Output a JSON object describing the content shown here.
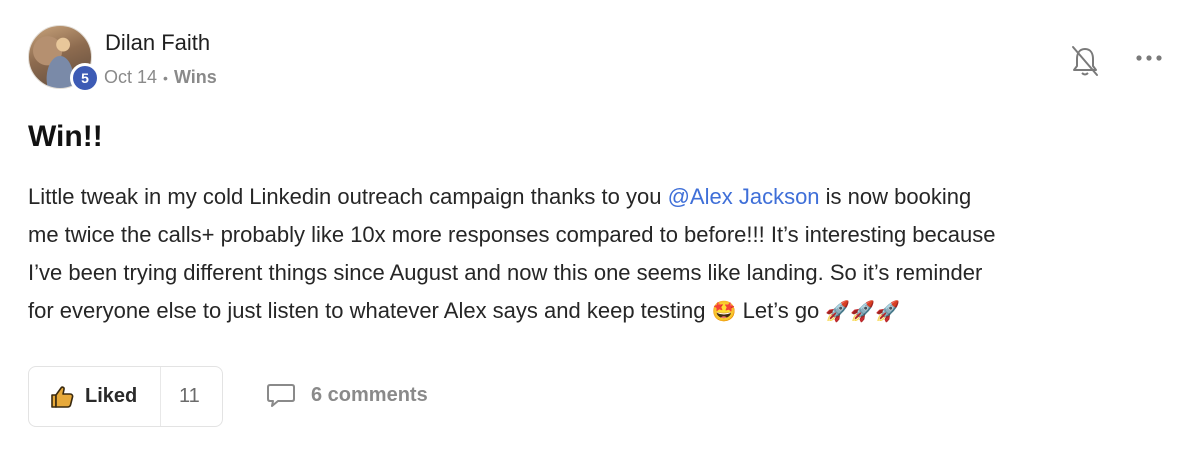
{
  "post": {
    "author": {
      "name": "Dilan Faith",
      "level": "5"
    },
    "meta": {
      "date": "Oct 14",
      "separator": "•",
      "category": "Wins"
    },
    "title": "Win!!",
    "body": {
      "line1_before": "Little tweak in my cold Linkedin outreach campaign thanks to you ",
      "mention": "@Alex Jackson",
      "line1_after": " is now booking",
      "line2": "me twice the calls+ probably like 10x more responses compared to before!!! It’s interesting because",
      "line3": "I’ve been trying different things since August and now this one seems like landing. So it’s reminder",
      "line4_before": "for everyone else to just listen to whatever Alex says and keep testing ",
      "emoji_star": "🤩",
      "line4_mid": " Let’s go ",
      "emoji_rockets": "🚀🚀🚀"
    },
    "actions": {
      "like_label": "Liked",
      "like_count": "11",
      "comments_label": "6 comments"
    },
    "icons": {
      "bell": "bell-off-icon",
      "more": "more-horizontal-icon",
      "like": "thumbs-up-icon",
      "comment": "comment-bubble-icon"
    },
    "colors": {
      "mention": "#3f6fd8",
      "level_badge": "#3d5bb5",
      "like_icon": "#e7a93a"
    }
  }
}
